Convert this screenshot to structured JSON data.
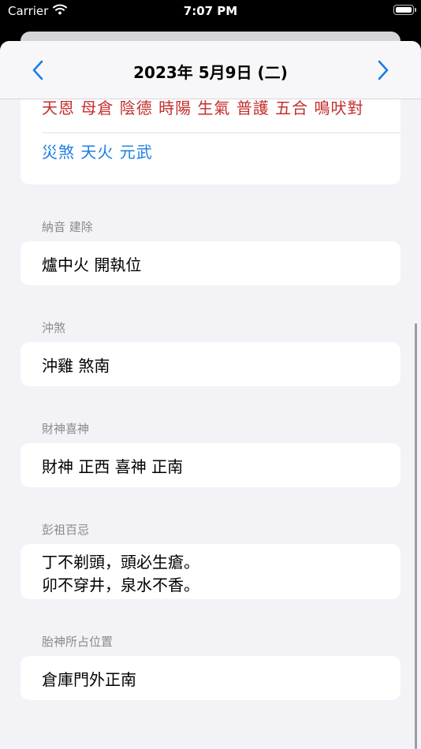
{
  "status_bar": {
    "carrier": "Carrier",
    "time": "7:07 PM"
  },
  "nav": {
    "title": "2023年 5月9日 (二)",
    "prev_icon": "chevron-left-icon",
    "next_icon": "chevron-right-icon"
  },
  "gods": {
    "auspicious": "天恩 母倉 陰德 時陽 生氣 普護 五合 鳴吠對",
    "inauspicious": "災煞 天火 元武"
  },
  "sections": {
    "nayin": {
      "label": "納音 建除",
      "value": "爐中火  開執位"
    },
    "clash": {
      "label": "沖煞",
      "value": "沖雞  煞南"
    },
    "wealth": {
      "label": "財神喜神",
      "value": "財神 正西   喜神 正南"
    },
    "pengzu": {
      "label": "彭祖百忌",
      "line1": "丁不剃頭，頭必生瘡。",
      "line2": "卯不穿井，泉水不香。"
    },
    "fetal": {
      "label": "胎神所占位置",
      "value": "倉庫門外正南"
    }
  },
  "colors": {
    "accent": "#1a7ee0",
    "auspicious": "#c42d2d",
    "background": "#f2f2f7"
  }
}
